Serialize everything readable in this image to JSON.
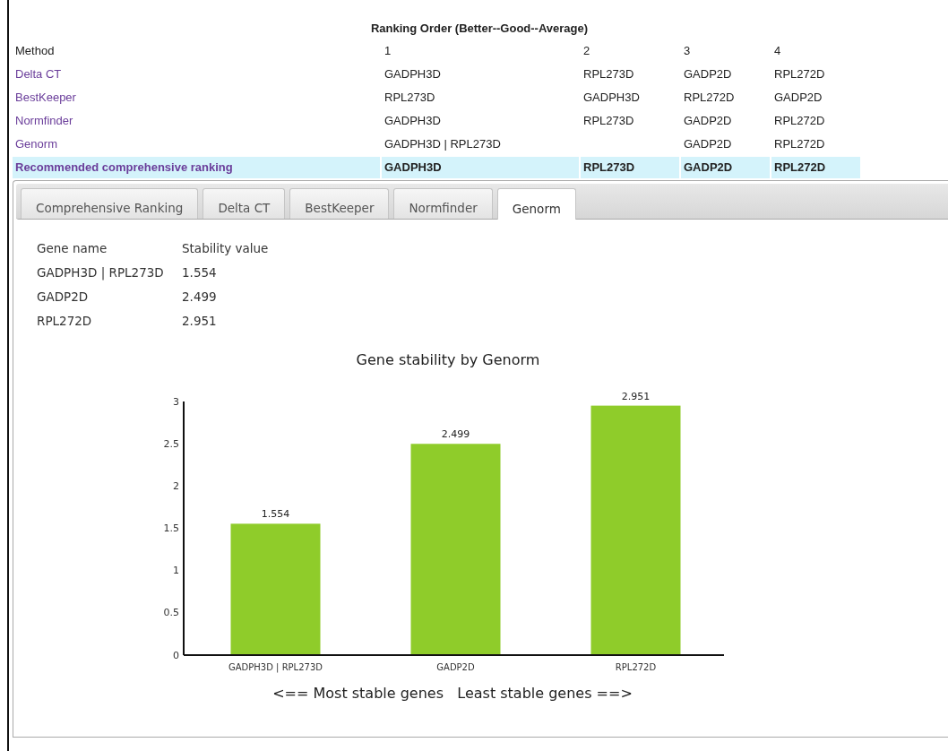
{
  "ranking": {
    "title": "Ranking Order (Better--Good--Average)",
    "columns": [
      "Method",
      "1",
      "2",
      "3",
      "4"
    ],
    "rows": [
      {
        "cells": [
          "Delta CT",
          "GADPH3D",
          "RPL273D",
          "GADP2D",
          "RPL272D"
        ],
        "highlighted": false
      },
      {
        "cells": [
          "BestKeeper",
          "RPL273D",
          "GADPH3D",
          "RPL272D",
          "GADP2D"
        ],
        "highlighted": false
      },
      {
        "cells": [
          "Normfinder",
          "GADPH3D",
          "RPL273D",
          "GADP2D",
          "RPL272D"
        ],
        "highlighted": false
      },
      {
        "cells": [
          "Genorm",
          "GADPH3D | RPL273D",
          "",
          "GADP2D",
          "RPL272D"
        ],
        "highlighted": false
      },
      {
        "cells": [
          "Recommended comprehensive ranking",
          "GADPH3D",
          "RPL273D",
          "GADP2D",
          "RPL272D"
        ],
        "highlighted": true
      }
    ]
  },
  "tabs": [
    {
      "label": "Comprehensive Ranking",
      "selected": false
    },
    {
      "label": "Delta CT",
      "selected": false
    },
    {
      "label": "BestKeeper",
      "selected": false
    },
    {
      "label": "Normfinder",
      "selected": false
    },
    {
      "label": "Genorm",
      "selected": true
    }
  ],
  "stability_table": {
    "columns": [
      "Gene name",
      "Stability value"
    ],
    "rows": [
      [
        "GADPH3D | RPL273D",
        "1.554"
      ],
      [
        "GADP2D",
        "2.499"
      ],
      [
        "RPL272D",
        "2.951"
      ]
    ]
  },
  "chart_data": {
    "type": "bar",
    "title": "Gene stability by Genorm",
    "xlabel": "<== Most stable genes   Least stable genes ==>",
    "categories": [
      "GADPH3D | RPL273D",
      "GADP2D",
      "RPL272D"
    ],
    "series": [
      {
        "color": "#8fcc2a",
        "values": [
          1.554,
          2.499,
          2.951
        ]
      }
    ],
    "ylim": [
      0,
      3
    ],
    "yticks": [
      0,
      0.5,
      1,
      1.5,
      2,
      2.5,
      3
    ],
    "data_labels": true
  }
}
